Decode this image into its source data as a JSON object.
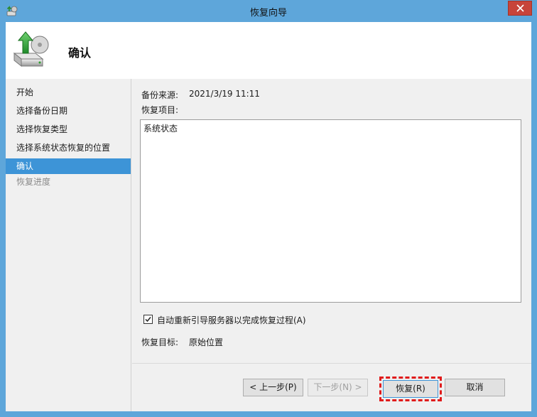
{
  "window": {
    "title": "恢复向导"
  },
  "header": {
    "title": "确认"
  },
  "nav": {
    "items": [
      {
        "label": "开始",
        "state": "normal"
      },
      {
        "label": "选择备份日期",
        "state": "normal"
      },
      {
        "label": "选择恢复类型",
        "state": "normal"
      },
      {
        "label": "选择系统状态恢复的位置",
        "state": "normal"
      },
      {
        "label": "确认",
        "state": "active"
      },
      {
        "label": "恢复进度",
        "state": "disabled"
      }
    ]
  },
  "content": {
    "backup_source_label": "备份来源:",
    "backup_source_value": "2021/3/19 11:11",
    "recover_items_label": "恢复项目:",
    "recover_items": [
      "系统状态"
    ],
    "auto_reboot_label": "自动重新引导服务器以完成恢复过程(A)",
    "auto_reboot_checked": true,
    "recover_target_label": "恢复目标:",
    "recover_target_value": "原始位置"
  },
  "buttons": {
    "prev": "< 上一步(P)",
    "next": "下一步(N) >",
    "recover": "恢复(R)",
    "cancel": "取消"
  },
  "colors": {
    "titlebar": "#5ea6da",
    "selection": "#3d94d7",
    "highlight": "#e01b1b",
    "close": "#c7443a"
  }
}
